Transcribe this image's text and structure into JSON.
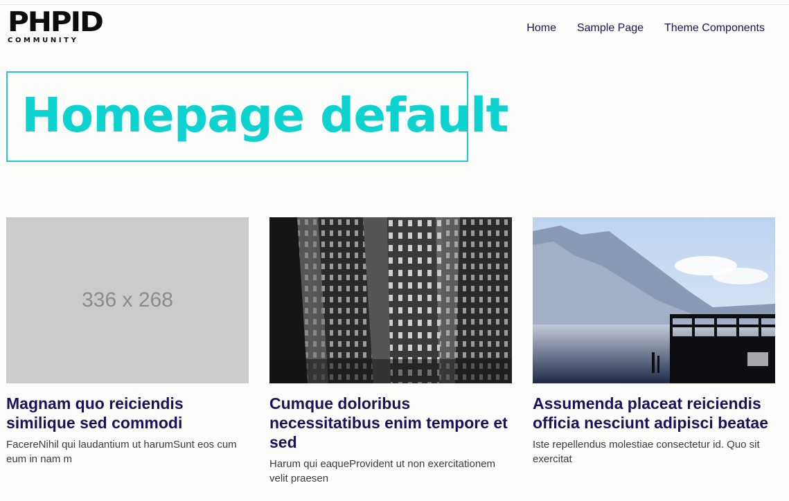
{
  "logo": {
    "main": "PHPID",
    "sub": "COMMUNITY"
  },
  "nav": {
    "items": [
      "Home",
      "Sample Page",
      "Theme Components"
    ]
  },
  "page": {
    "title": "Homepage default"
  },
  "cards": [
    {
      "image": {
        "kind": "placeholder",
        "text": "336 x 268"
      },
      "title": "Magnam quo reiciendis similique sed commodi",
      "excerpt": "FacereNihil qui laudantium ut harumSunt eos cum eum in nam m"
    },
    {
      "image": {
        "kind": "photo-building"
      },
      "title": "Cumque doloribus necessitatibus enim tempore et sed",
      "excerpt": "Harum qui eaqueProvident ut non exercitationem velit praesen"
    },
    {
      "image": {
        "kind": "photo-lake-pier"
      },
      "title": "Assumenda placeat reiciendis officia nesciunt adipisci beatae",
      "excerpt": "Iste repellendus molestiae consectetur id. Quo sit exercitat"
    }
  ],
  "colors": {
    "nav": "#1c0f5e",
    "heading": "#0dd3d0",
    "heading_border": "#20c7d6",
    "card_title": "#1c0f5e"
  }
}
